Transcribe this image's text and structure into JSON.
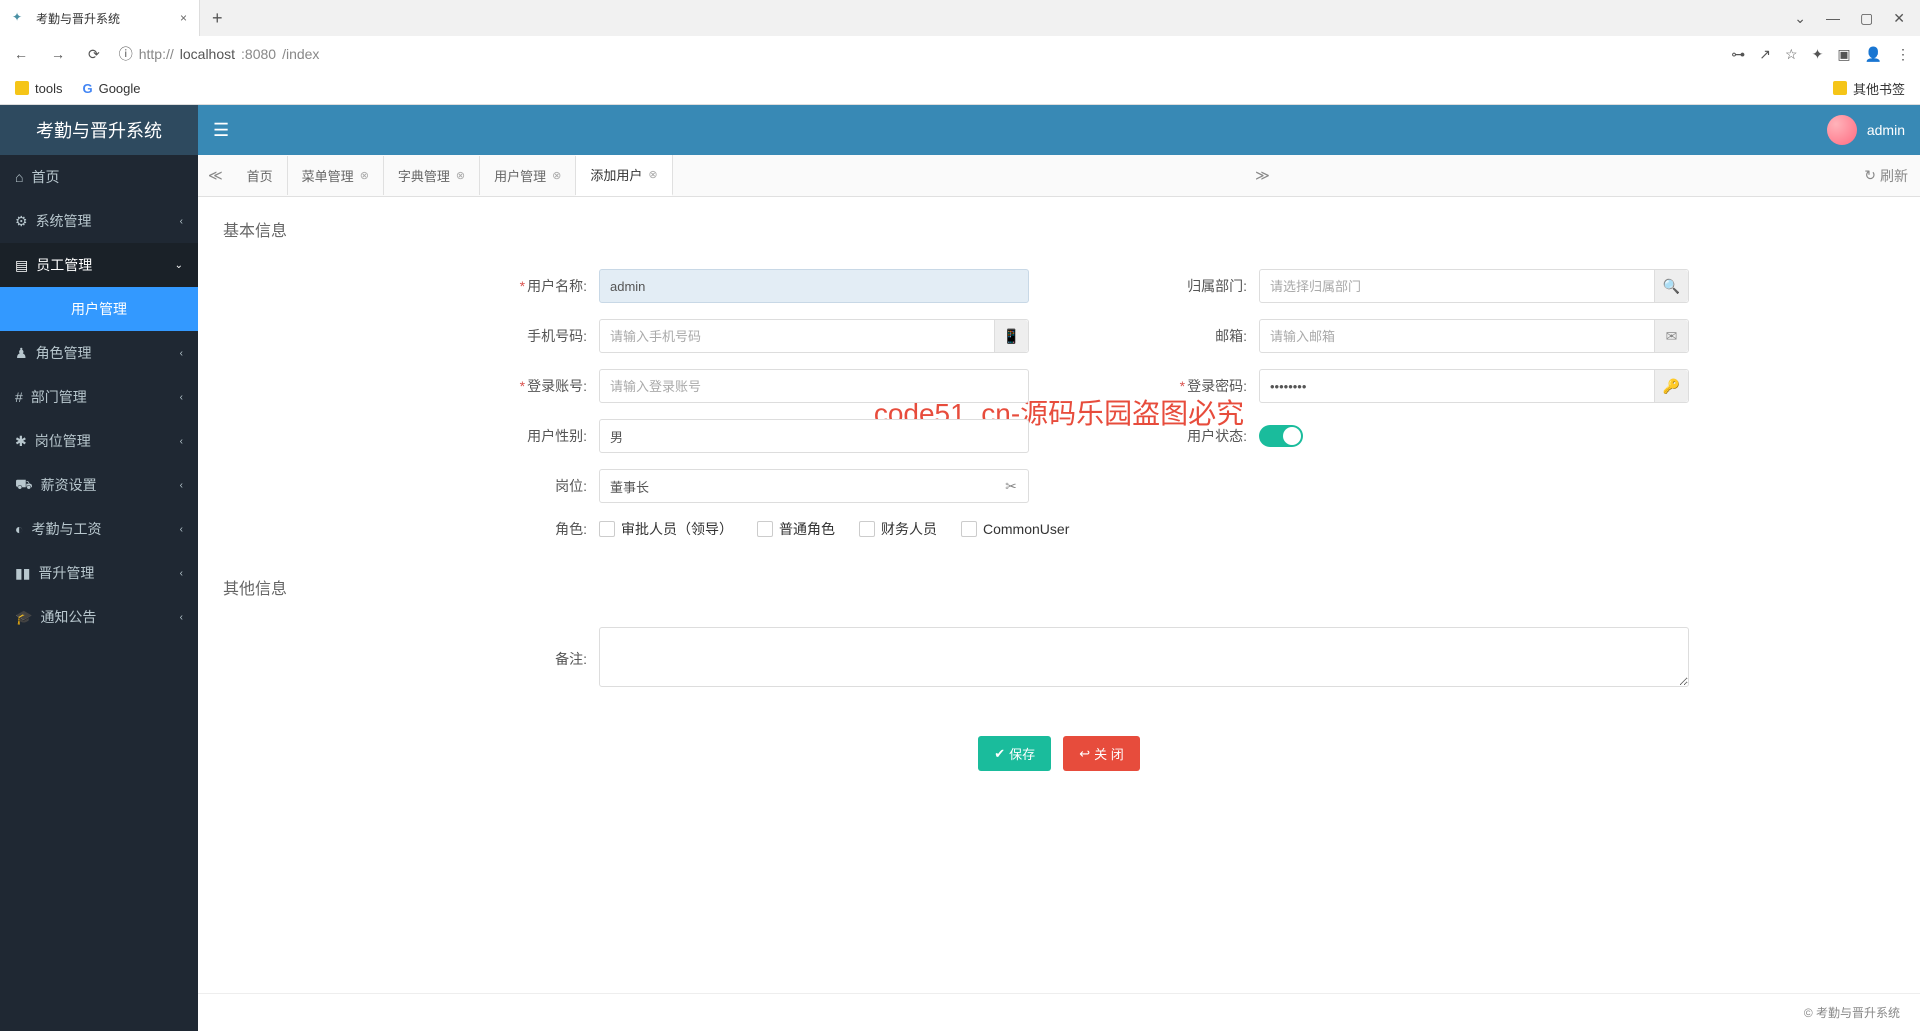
{
  "browser": {
    "tab_title": "考勤与晋升系统",
    "url": "http://localhost:8080/index",
    "url_display_host": "localhost",
    "url_display_port": ":8080",
    "url_display_path": "/index",
    "bookmarks": {
      "tools": "tools",
      "google": "Google",
      "other": "其他书签"
    }
  },
  "app": {
    "title": "考勤与晋升系统",
    "user": "admin"
  },
  "sidebar": {
    "items": [
      {
        "icon": "home",
        "label": "首页"
      },
      {
        "icon": "gear",
        "label": "系统管理",
        "expandable": true
      },
      {
        "icon": "file",
        "label": "员工管理",
        "expandable": true,
        "active": true
      },
      {
        "icon": "user",
        "label": "角色管理",
        "expandable": true
      },
      {
        "icon": "hash",
        "label": "部门管理",
        "expandable": true
      },
      {
        "icon": "snow",
        "label": "岗位管理",
        "expandable": true
      },
      {
        "icon": "cart",
        "label": "薪资设置",
        "expandable": true
      },
      {
        "icon": "clock",
        "label": "考勤与工资",
        "expandable": true
      },
      {
        "icon": "bars",
        "label": "晋升管理",
        "expandable": true
      },
      {
        "icon": "cap",
        "label": "通知公告",
        "expandable": true
      }
    ],
    "submenu": {
      "user_mgmt": "用户管理"
    }
  },
  "tabs": [
    {
      "label": "首页",
      "closable": false
    },
    {
      "label": "菜单管理",
      "closable": true
    },
    {
      "label": "字典管理",
      "closable": true
    },
    {
      "label": "用户管理",
      "closable": true
    },
    {
      "label": "添加用户",
      "closable": true,
      "active": true
    }
  ],
  "refresh_label": "刷新",
  "form": {
    "section_basic": "基本信息",
    "section_other": "其他信息",
    "fields": {
      "username": {
        "label": "用户名称:",
        "value": "admin",
        "required": true
      },
      "dept": {
        "label": "归属部门:",
        "placeholder": "请选择归属部门"
      },
      "phone": {
        "label": "手机号码:",
        "placeholder": "请输入手机号码"
      },
      "email": {
        "label": "邮箱:",
        "placeholder": "请输入邮箱"
      },
      "account": {
        "label": "登录账号:",
        "placeholder": "请输入登录账号",
        "required": true
      },
      "password": {
        "label": "登录密码:",
        "value": "••••••••",
        "required": true
      },
      "gender": {
        "label": "用户性别:",
        "value": "男"
      },
      "status": {
        "label": "用户状态:"
      },
      "position": {
        "label": "岗位:",
        "value": "董事长"
      },
      "role": {
        "label": "角色:",
        "options": [
          "审批人员（领导）",
          "普通角色",
          "财务人员",
          "CommonUser"
        ]
      },
      "remark": {
        "label": "备注:"
      }
    },
    "buttons": {
      "save": "保存",
      "close": "关 闭"
    }
  },
  "footer": "© 考勤与晋升系统",
  "watermarks": [
    "code51.cn",
    "code51. cn-源码乐园盗图必究"
  ]
}
